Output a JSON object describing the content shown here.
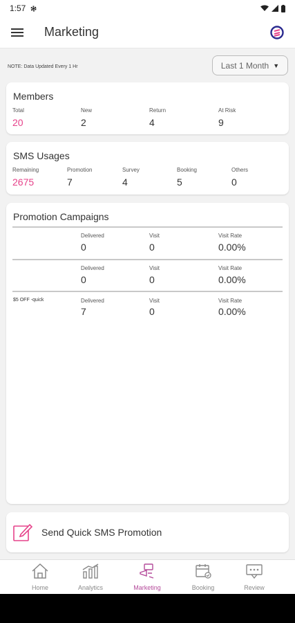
{
  "status": {
    "time": "1:57"
  },
  "appbar": {
    "title": "Marketing"
  },
  "filter": {
    "note": "NOTE: Data Updated Every 1 Hr",
    "period": "Last 1 Month"
  },
  "members": {
    "title": "Members",
    "stats": [
      {
        "label": "Total",
        "value": "20"
      },
      {
        "label": "New",
        "value": "2"
      },
      {
        "label": "Return",
        "value": "4"
      },
      {
        "label": "At Risk",
        "value": "9"
      }
    ]
  },
  "sms": {
    "title": "SMS Usages",
    "stats": [
      {
        "label": "Remaining",
        "value": "2675"
      },
      {
        "label": "Promotion",
        "value": "7"
      },
      {
        "label": "Survey",
        "value": "4"
      },
      {
        "label": "Booking",
        "value": "5"
      },
      {
        "label": "Others",
        "value": "0"
      }
    ]
  },
  "campaigns": {
    "title": "Promotion Campaigns",
    "col_delivered": "Delivered",
    "col_visit": "Visit",
    "col_rate": "Visit Rate",
    "rows": [
      {
        "name": "",
        "delivered": "0",
        "visit": "0",
        "rate": "0.00%"
      },
      {
        "name": "",
        "delivered": "0",
        "visit": "0",
        "rate": "0.00%"
      },
      {
        "name": "$5 OFF -quick",
        "delivered": "7",
        "visit": "0",
        "rate": "0.00%"
      }
    ]
  },
  "quick": {
    "label": "Send Quick SMS Promotion"
  },
  "nav": [
    {
      "label": "Home"
    },
    {
      "label": "Analytics"
    },
    {
      "label": "Marketing"
    },
    {
      "label": "Booking"
    },
    {
      "label": "Review"
    }
  ],
  "colors": {
    "accent": "#e6428a",
    "nav_active": "#b44a9a",
    "logo_blue": "#2a2a8f"
  }
}
